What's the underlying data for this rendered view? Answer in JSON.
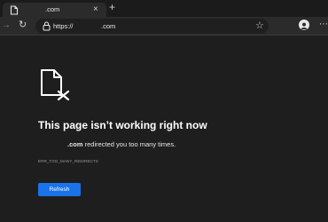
{
  "browser": {
    "tab": {
      "title": ".com",
      "close_glyph": "×"
    },
    "new_tab_glyph": "+",
    "toolbar": {
      "back_glyph": "→",
      "reload_glyph": "↻",
      "url_scheme": "https://",
      "url_host": ".com",
      "star_glyph": "☆",
      "menu_glyph": "⋯"
    }
  },
  "error_page": {
    "icon": "broken-file-icon",
    "title": "This page isn’t working right now",
    "message_host": ".com",
    "message_text": "redirected you too many times.",
    "error_code": "ERR_TOO_MANY_REDIRECTS",
    "refresh_label": "Refresh"
  },
  "colors": {
    "page_background": "#1e1e1e",
    "toolbar_background": "#2b2b2b",
    "accent": "#1a73e8"
  }
}
